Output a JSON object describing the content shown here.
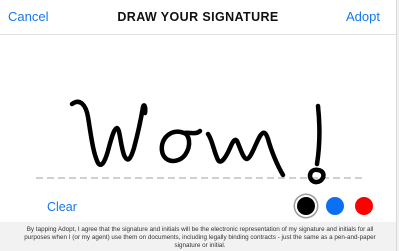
{
  "header": {
    "cancel_label": "Cancel",
    "title": "DRAW YOUR SIGNATURE",
    "adopt_label": "Adopt"
  },
  "pad": {
    "drawn_text": "Wow!",
    "clear_label": "Clear",
    "ink_colors": [
      {
        "name": "black",
        "hex": "#000000",
        "selected": true
      },
      {
        "name": "blue",
        "hex": "#0a6ff0",
        "selected": false
      },
      {
        "name": "red",
        "hex": "#ff0000",
        "selected": false
      }
    ]
  },
  "disclaimer": "By tapping Adopt, I agree that the signature and initials will be the electronic representation of my signature and initials for all purposes when I (or my agent) use them on documents, including legally binding contracts - just the same as a pen-and-paper signature or initial."
}
